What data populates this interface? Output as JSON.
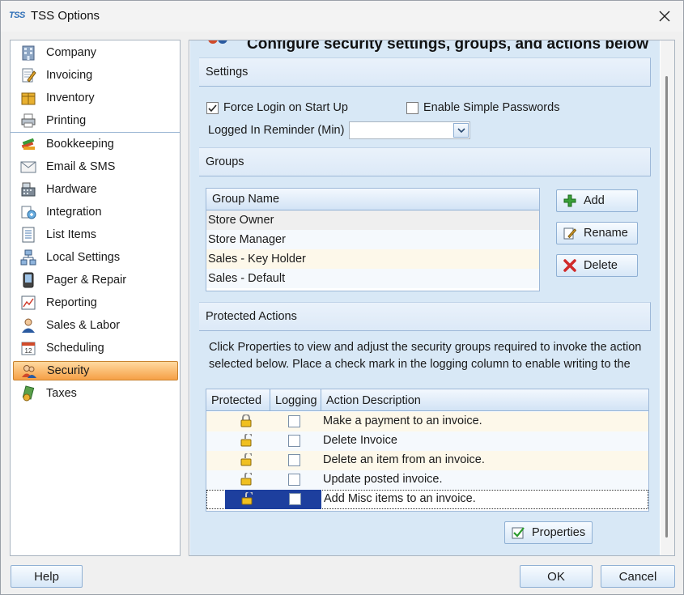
{
  "window": {
    "logo_text": "TSS",
    "title": "TSS Options",
    "close_icon": "close-icon"
  },
  "sidebar": {
    "items": [
      {
        "label": "Company",
        "icon": "building-icon"
      },
      {
        "label": "Invoicing",
        "icon": "invoice-pencil-icon"
      },
      {
        "label": "Inventory",
        "icon": "boxes-icon"
      },
      {
        "label": "Printing",
        "icon": "printer-icon"
      },
      {
        "label": "Bookkeeping",
        "icon": "books-icon"
      },
      {
        "label": "Email & SMS",
        "icon": "envelope-icon"
      },
      {
        "label": "Hardware",
        "icon": "cash-register-icon"
      },
      {
        "label": "Integration",
        "icon": "integration-icon"
      },
      {
        "label": "List Items",
        "icon": "list-icon"
      },
      {
        "label": "Local Settings",
        "icon": "network-icon"
      },
      {
        "label": "Pager & Repair",
        "icon": "pager-icon"
      },
      {
        "label": "Reporting",
        "icon": "report-chart-icon"
      },
      {
        "label": "Sales & Labor",
        "icon": "salesperson-icon"
      },
      {
        "label": "Scheduling",
        "icon": "calendar-icon"
      },
      {
        "label": "Security",
        "icon": "users-security-icon"
      },
      {
        "label": "Taxes",
        "icon": "tax-money-icon"
      }
    ],
    "selected": "Security"
  },
  "main": {
    "heading": "Configure security settings, groups, and actions below",
    "settings": {
      "header": "Settings",
      "force_login_label": "Force Login on Start Up",
      "force_login_checked": true,
      "simple_passwords_label": "Enable Simple Passwords",
      "simple_passwords_checked": false,
      "reminder_label": "Logged In Reminder (Min)",
      "reminder_value": ""
    },
    "groups": {
      "header": "Groups",
      "column": "Group Name",
      "rows": [
        "Store Owner",
        "Store Manager",
        "Sales - Key Holder",
        "Sales - Default"
      ],
      "add_label": "Add",
      "rename_label": "Rename",
      "delete_label": "Delete"
    },
    "protected_actions": {
      "header": "Protected Actions",
      "description_line1": "Click Properties to view and adjust the security groups required to invoke the action",
      "description_line2": "selected below. Place a check mark in the logging column to enable writing to the",
      "columns": [
        "Protected",
        "Logging",
        "Action Description"
      ],
      "rows": [
        {
          "description": "Make a payment to an invoice.",
          "locked": true,
          "logging": false
        },
        {
          "description": "Delete Invoice",
          "locked": false,
          "logging": false
        },
        {
          "description": "Delete an item from an invoice.",
          "locked": false,
          "logging": false
        },
        {
          "description": "Update posted invoice.",
          "locked": false,
          "logging": false
        },
        {
          "description": "Add Misc items to an invoice.",
          "locked": false,
          "logging": false
        }
      ],
      "properties_label": "Properties"
    }
  },
  "footer": {
    "help_label": "Help",
    "ok_label": "OK",
    "cancel_label": "Cancel"
  },
  "colors": {
    "accent_blue": "#d8e8f6",
    "selected_orange": "#f6a046",
    "selected_row": "#1d3f9e"
  }
}
